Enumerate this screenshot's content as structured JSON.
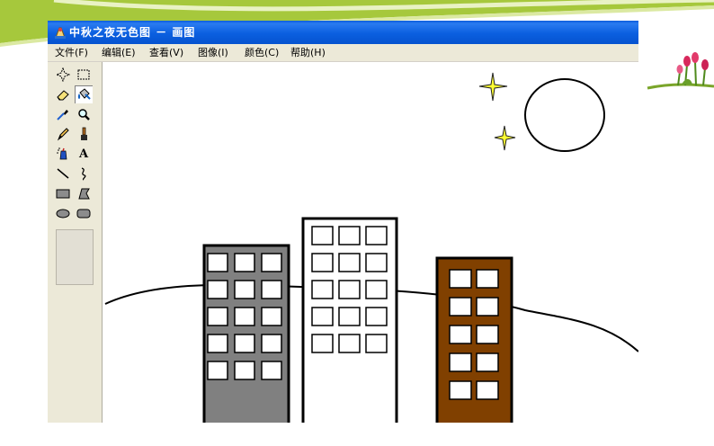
{
  "window": {
    "title": "中秋之夜无色图 － 画图"
  },
  "menu": [
    {
      "label": "文件(F)"
    },
    {
      "label": "编辑(E)"
    },
    {
      "label": "查看(V)"
    },
    {
      "label": "图像(I)"
    },
    {
      "label": "颜色(C)"
    },
    {
      "label": "帮助(H)"
    }
  ],
  "tools": [
    {
      "icon": "free-select-icon"
    },
    {
      "icon": "rect-select-icon"
    },
    {
      "icon": "eraser-icon"
    },
    {
      "icon": "fill-bucket-icon",
      "selected": true
    },
    {
      "icon": "color-picker-icon"
    },
    {
      "icon": "magnifier-icon"
    },
    {
      "icon": "pencil-icon"
    },
    {
      "icon": "brush-icon"
    },
    {
      "icon": "airbrush-icon"
    },
    {
      "icon": "text-icon",
      "glyph": "A"
    },
    {
      "icon": "line-icon"
    },
    {
      "icon": "curve-icon"
    },
    {
      "icon": "rectangle-icon"
    },
    {
      "icon": "polygon-icon"
    },
    {
      "icon": "ellipse-icon"
    },
    {
      "icon": "rounded-rect-icon"
    }
  ],
  "drawing": {
    "buildings": [
      {
        "name": "gray-building",
        "fill": "#808080",
        "window_columns": 3,
        "window_rows": 5
      },
      {
        "name": "white-building",
        "fill": "#ffffff",
        "window_columns": 3,
        "window_rows": 5
      },
      {
        "name": "brown-building",
        "fill": "#804000",
        "window_columns": 2,
        "window_rows": 5
      }
    ],
    "star_color": "#ffff33",
    "moon_fill": "#ffffff"
  },
  "colors": {
    "title_bar": "#0b5fe0",
    "window_face": "#ece9d8",
    "banner_green": "#a6c83c"
  }
}
